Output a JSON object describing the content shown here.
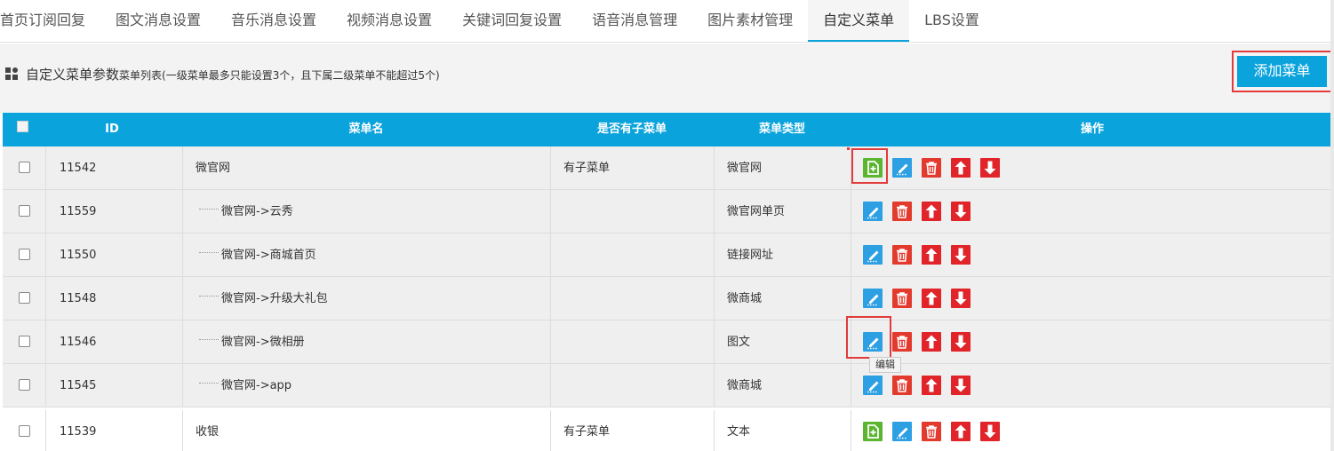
{
  "tabs": [
    {
      "label": "首页订阅回复"
    },
    {
      "label": "图文消息设置"
    },
    {
      "label": "音乐消息设置"
    },
    {
      "label": "视频消息设置"
    },
    {
      "label": "关键词回复设置"
    },
    {
      "label": "语音消息管理"
    },
    {
      "label": "图片素材管理"
    },
    {
      "label": "自定义菜单",
      "active": true
    },
    {
      "label": "LBS设置"
    }
  ],
  "header": {
    "title": "自定义菜单参数",
    "subtitle": "菜单列表(一级菜单最多只能设置3个，且下属二级菜单不能超过5个)",
    "add_button": "添加菜单"
  },
  "table": {
    "columns": {
      "id": "ID",
      "name": "菜单名",
      "has_sub": "是否有子菜单",
      "type": "菜单类型",
      "ops": "操作"
    },
    "rows": [
      {
        "id": "11542",
        "name": "微官网",
        "has_sub": "有子菜单",
        "type": "微官网",
        "level": 1
      },
      {
        "id": "11559",
        "name": "微官网->云秀",
        "has_sub": "",
        "type": "微官网单页",
        "level": 2
      },
      {
        "id": "11550",
        "name": "微官网->商城首页",
        "has_sub": "",
        "type": "链接网址",
        "level": 2
      },
      {
        "id": "11548",
        "name": "微官网->升级大礼包",
        "has_sub": "",
        "type": "微商城",
        "level": 2
      },
      {
        "id": "11546",
        "name": "微官网->微相册",
        "has_sub": "",
        "type": "图文",
        "level": 2
      },
      {
        "id": "11545",
        "name": "微官网->app",
        "has_sub": "",
        "type": "微商城",
        "level": 2
      },
      {
        "id": "11539",
        "name": "收银",
        "has_sub": "有子菜单",
        "type": "文本",
        "level": 1
      }
    ]
  },
  "tooltip": "编辑",
  "icons": {
    "add": "add-submenu-icon",
    "edit": "edit-icon",
    "delete": "trash-icon",
    "up": "arrow-up-icon",
    "down": "arrow-down-icon"
  },
  "colors": {
    "accent": "#0ba3dc",
    "highlight": "#e23b3b",
    "add": "#5cb531",
    "edit": "#2d9fe3",
    "delete": "#e33a2e",
    "move": "#e0242a"
  }
}
